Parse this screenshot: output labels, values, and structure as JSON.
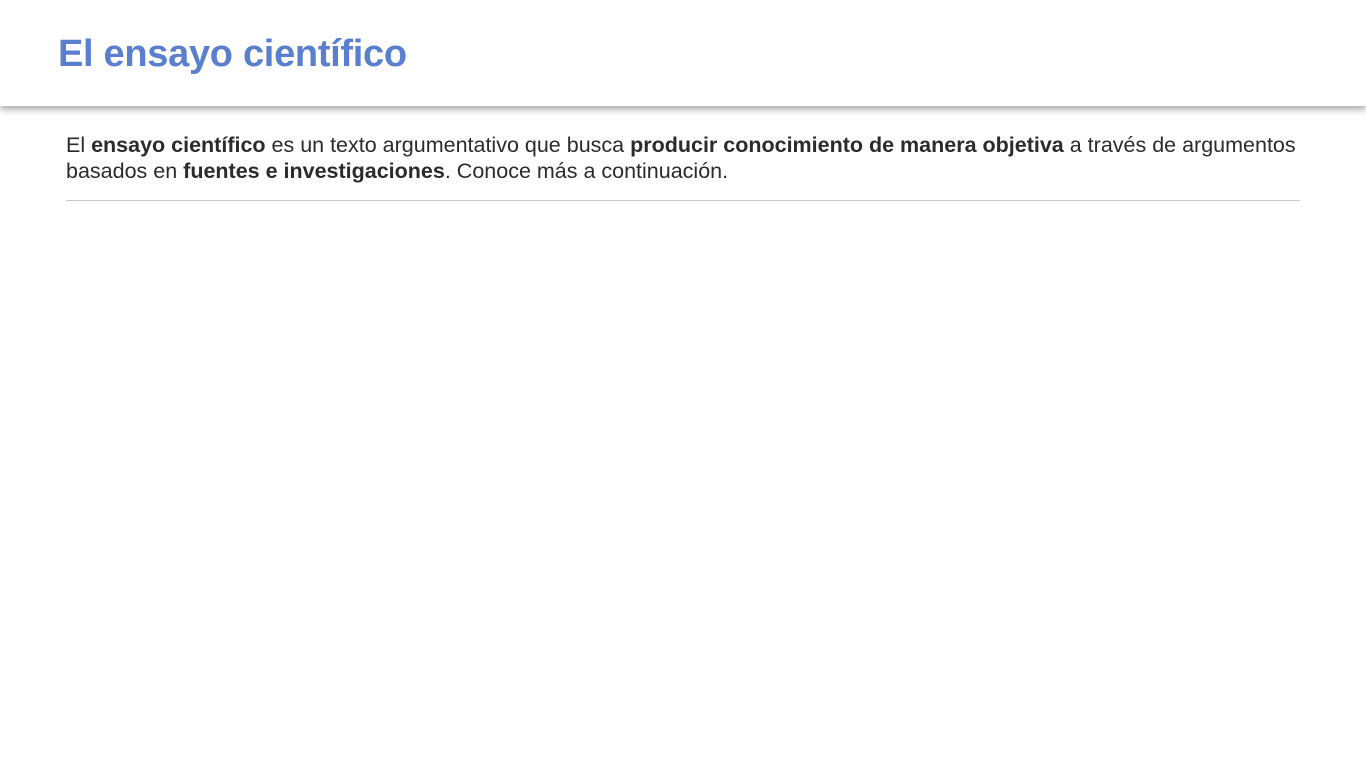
{
  "header": {
    "title": "El ensayo científico"
  },
  "intro": {
    "segments": [
      {
        "text": "El ",
        "bold": false
      },
      {
        "text": "ensayo científico",
        "bold": true
      },
      {
        "text": " es un texto argumentativo que busca ",
        "bold": false
      },
      {
        "text": "producir conocimiento de manera objetiva",
        "bold": true
      },
      {
        "text": " a través de argumentos basados en ",
        "bold": false
      },
      {
        "text": "fuentes e investigaciones",
        "bold": true
      },
      {
        "text": ". Conoce más a continuación.",
        "bold": false
      }
    ]
  },
  "colors": {
    "title": "#5a7fce",
    "text": "#2b2b2b",
    "divider": "#c8c8c8"
  }
}
